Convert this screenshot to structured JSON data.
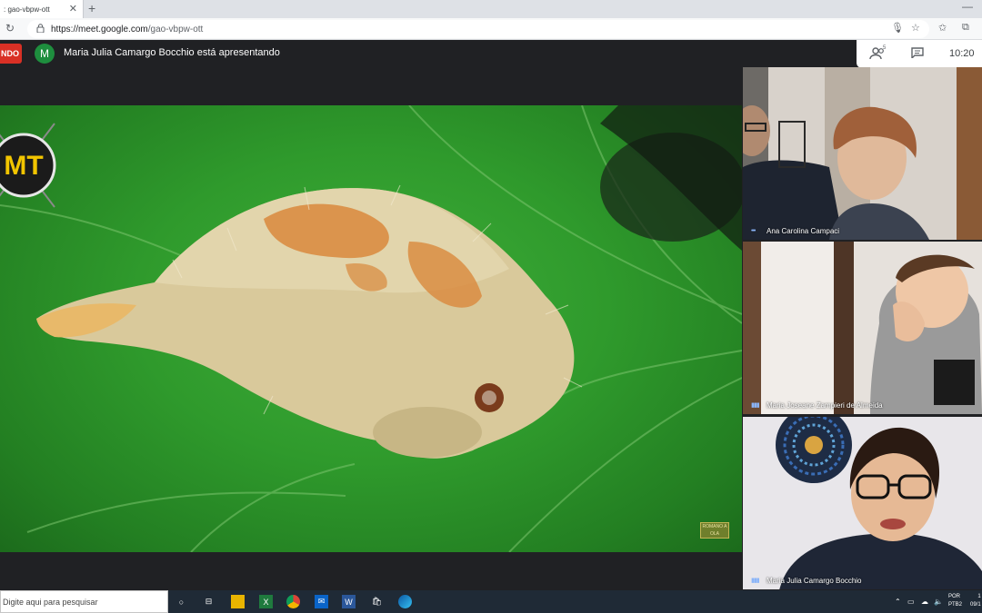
{
  "browser": {
    "tab_title": ": gao-vbpw-ott",
    "url_host": "https://meet.google.com",
    "url_path": "/gao-vbpw-ott"
  },
  "meet": {
    "recording_badge": "NDO",
    "presenter_initial": "M",
    "presenting_text": "Maria Julia Camargo Bocchio está apresentando",
    "people_count": "5",
    "clock": "10:20"
  },
  "slide": {
    "logo_text": "MT",
    "watermark_text": "ROMANO A OLA"
  },
  "participants": [
    {
      "name": "Ana Carolina Campaci"
    },
    {
      "name": "Maria Joseane Zampieri de Almeida"
    },
    {
      "name": "Maria Julia Camargo Bocchio"
    }
  ],
  "taskbar": {
    "search_placeholder": "Digite aqui para pesquisar",
    "lang_line1": "POR",
    "lang_line2": "PTB2",
    "time_line1": "1",
    "time_line2": "09/1"
  }
}
